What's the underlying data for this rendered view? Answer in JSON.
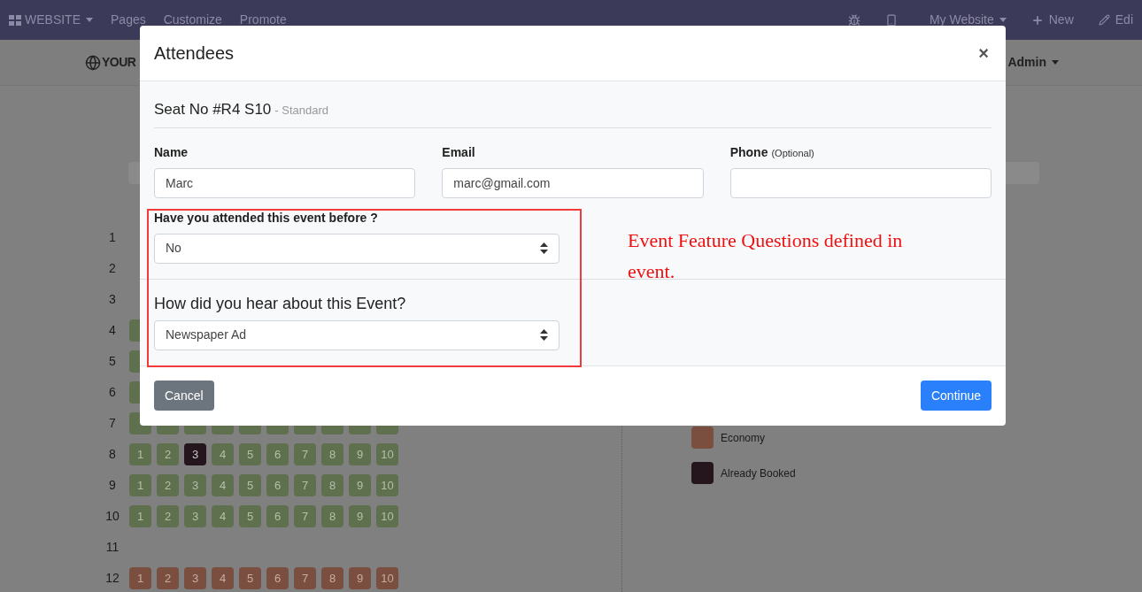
{
  "top_bar": {
    "app_menu": "WEBSITE",
    "menu": [
      "Pages",
      "Customize",
      "Promote"
    ],
    "website_menu": "My Website",
    "new_label": "New",
    "edit_label": "Edi"
  },
  "header": {
    "logo_text": "YOUR",
    "user_menu": "Admin"
  },
  "seat_rows": [
    {
      "label": "1",
      "seats": []
    },
    {
      "label": "2",
      "seats": []
    },
    {
      "label": "3",
      "seats": []
    },
    {
      "label": "4",
      "seats": [
        {
          "kind": "standard"
        }
      ]
    },
    {
      "label": "5",
      "seats": [
        {
          "kind": "standard"
        }
      ]
    },
    {
      "label": "6",
      "seats": [
        {
          "kind": "standard"
        }
      ]
    },
    {
      "label": "7",
      "seats": [
        {
          "kind": "standard"
        },
        {
          "kind": "standard"
        },
        {
          "kind": "standard"
        },
        {
          "kind": "standard"
        },
        {
          "kind": "standard"
        },
        {
          "kind": "standard"
        },
        {
          "kind": "standard"
        },
        {
          "kind": "standard"
        },
        {
          "kind": "standard"
        },
        {
          "kind": "standard"
        }
      ]
    },
    {
      "label": "8",
      "seats": [
        {
          "kind": "standard",
          "label": "1"
        },
        {
          "kind": "standard",
          "label": "2"
        },
        {
          "kind": "booked",
          "label": "3"
        },
        {
          "kind": "standard",
          "label": "4"
        },
        {
          "kind": "standard",
          "label": "5"
        },
        {
          "kind": "standard",
          "label": "6"
        },
        {
          "kind": "standard",
          "label": "7"
        },
        {
          "kind": "standard",
          "label": "8"
        },
        {
          "kind": "standard",
          "label": "9"
        },
        {
          "kind": "standard",
          "label": "10"
        }
      ]
    },
    {
      "label": "9",
      "seats": [
        {
          "kind": "standard",
          "label": "1"
        },
        {
          "kind": "standard",
          "label": "2"
        },
        {
          "kind": "standard",
          "label": "3"
        },
        {
          "kind": "standard",
          "label": "4"
        },
        {
          "kind": "standard",
          "label": "5"
        },
        {
          "kind": "standard",
          "label": "6"
        },
        {
          "kind": "standard",
          "label": "7"
        },
        {
          "kind": "standard",
          "label": "8"
        },
        {
          "kind": "standard",
          "label": "9"
        },
        {
          "kind": "standard",
          "label": "10"
        }
      ]
    },
    {
      "label": "10",
      "seats": [
        {
          "kind": "standard",
          "label": "1"
        },
        {
          "kind": "standard",
          "label": "2"
        },
        {
          "kind": "standard",
          "label": "3"
        },
        {
          "kind": "standard",
          "label": "4"
        },
        {
          "kind": "standard",
          "label": "5"
        },
        {
          "kind": "standard",
          "label": "6"
        },
        {
          "kind": "standard",
          "label": "7"
        },
        {
          "kind": "standard",
          "label": "8"
        },
        {
          "kind": "standard",
          "label": "9"
        },
        {
          "kind": "standard",
          "label": "10"
        }
      ]
    },
    {
      "label": "11",
      "seats": []
    },
    {
      "label": "12",
      "seats": [
        {
          "kind": "economy",
          "label": "1"
        },
        {
          "kind": "economy",
          "label": "2"
        },
        {
          "kind": "economy",
          "label": "3"
        },
        {
          "kind": "economy",
          "label": "4"
        },
        {
          "kind": "economy",
          "label": "5"
        },
        {
          "kind": "economy",
          "label": "6"
        },
        {
          "kind": "economy",
          "label": "7"
        },
        {
          "kind": "economy",
          "label": "8"
        },
        {
          "kind": "economy",
          "label": "9"
        },
        {
          "kind": "economy",
          "label": "10"
        }
      ]
    }
  ],
  "legend": [
    {
      "label": "Economy",
      "color": "#7a4f40"
    },
    {
      "label": "Already Booked",
      "color": "#24161c"
    }
  ],
  "dialog": {
    "title": "Attendees",
    "close": "×",
    "seat_title": "Seat No #R4 S10",
    "seat_type": "- Standard",
    "fields": [
      {
        "label": "Name",
        "value": "Marc"
      },
      {
        "label": "Email",
        "value": "marc@gmail.com"
      },
      {
        "label": "Phone",
        "hint": "(Optional)"
      }
    ],
    "questions": [
      {
        "kind": "simple",
        "label": "Have you attended this event before ?",
        "value": "No"
      },
      {
        "kind": "prominent",
        "label": "How did you hear about this Event?",
        "value": "Newspaper Ad"
      }
    ],
    "annotation": "Event Feature Questions defined in event.",
    "buttons": [
      {
        "label": "Cancel",
        "kind": "secondary"
      },
      {
        "label": "Continue",
        "kind": "primary"
      }
    ]
  }
}
